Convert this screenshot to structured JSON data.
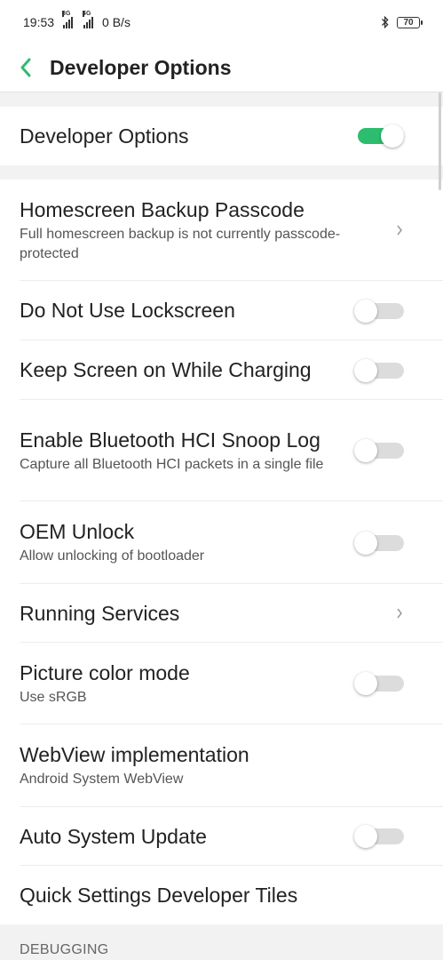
{
  "status_bar": {
    "time": "19:53",
    "net1": "3G",
    "net2": "4G",
    "speed": "0 B/s",
    "battery": "70"
  },
  "app_bar": {
    "title": "Developer Options"
  },
  "colors": {
    "accent": "#2dbd6e",
    "toggle_off": "#dcdcdc"
  },
  "items": [
    {
      "title": "Developer Options",
      "toggle": true
    },
    {
      "title": "Homescreen Backup Passcode",
      "subtitle": "Full homescreen backup is not currently passcode-protected",
      "chevron": true
    },
    {
      "title": "Do Not Use Lockscreen",
      "toggle": false
    },
    {
      "title": "Keep Screen on While Charging",
      "toggle": false
    },
    {
      "title": "Enable Bluetooth HCI Snoop Log",
      "subtitle": "Capture all Bluetooth HCI packets in a single file",
      "toggle": false
    },
    {
      "title": "OEM Unlock",
      "subtitle": "Allow unlocking of bootloader",
      "toggle": false
    },
    {
      "title": "Running Services",
      "chevron": true
    },
    {
      "title": "Picture color mode",
      "subtitle": "Use sRGB",
      "toggle": false
    },
    {
      "title": "WebView implementation",
      "subtitle": "Android System WebView"
    },
    {
      "title": "Auto System Update",
      "toggle": false
    },
    {
      "title": "Quick Settings Developer Tiles"
    }
  ],
  "section": {
    "debugging": "DEBUGGING"
  }
}
